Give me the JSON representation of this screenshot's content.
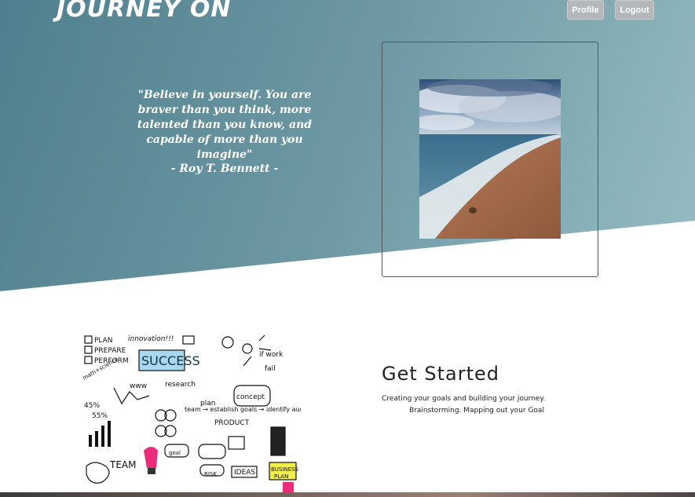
{
  "header": {
    "brand": "JOURNEY ON",
    "nav": {
      "profile": "Profile",
      "logout": "Logout"
    }
  },
  "hero": {
    "quote": "\"Believe in yourself. You are braver than you think, more talented than you know, and capable of more than you imagine\"",
    "author": "- Roy T. Bennett -",
    "image_icon": "beach-photo"
  },
  "get_started": {
    "title": "Get Started",
    "line1": "Creating your goals and building your journey.",
    "line2": "Brainstorming. Mapping out your Goal",
    "image_icon": "success-doodle-illustration",
    "doodle_words": [
      "PLAN",
      "PREPARE",
      "PERFORM",
      "innovation!!!",
      "SUCCESS",
      "research",
      "concept",
      "plan",
      "team",
      "establish goals",
      "identify audiences!",
      "if work",
      "fail",
      "PRODUCT",
      "TEAM",
      "IDEAS",
      "BUSINESS PLAN",
      "math+science",
      "RISK",
      "www",
      "45%",
      "55%"
    ]
  },
  "colors": {
    "hero_start": "#4f7f8e",
    "hero_end": "#9ec3c9",
    "button": "#b4b8bb"
  }
}
